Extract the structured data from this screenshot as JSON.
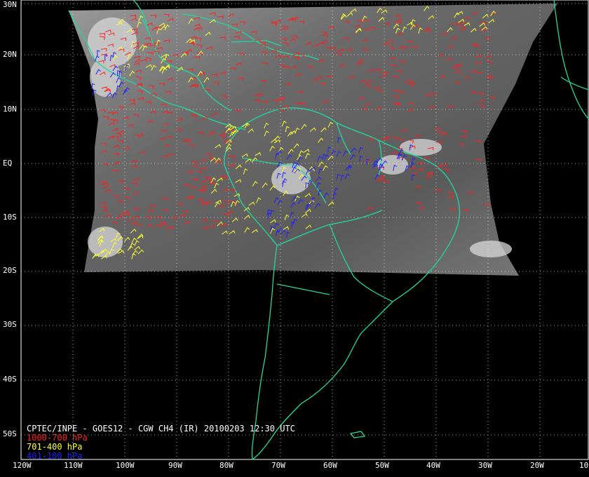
{
  "map": {
    "caption": "CPTEC/INPE - GOES12 - CGW CH4 (IR) 20100203 12:30 UTC",
    "legend": [
      {
        "label": "1000-700 hPa",
        "color": "#ff2020"
      },
      {
        "label": "701-400 hPa",
        "color": "#ffff30"
      },
      {
        "label": "401-100 hPa",
        "color": "#2020ff"
      }
    ],
    "lat_labels": [
      "30N",
      "20N",
      "10N",
      "EQ",
      "10S",
      "20S",
      "30S",
      "40S",
      "50S"
    ],
    "lon_labels": [
      "120W",
      "110W",
      "100W",
      "90W",
      "80W",
      "70W",
      "60W",
      "50W",
      "40W",
      "30W",
      "20W",
      "10"
    ],
    "coastline_color": "#20d8a0",
    "grid_color": "#ffffff"
  }
}
